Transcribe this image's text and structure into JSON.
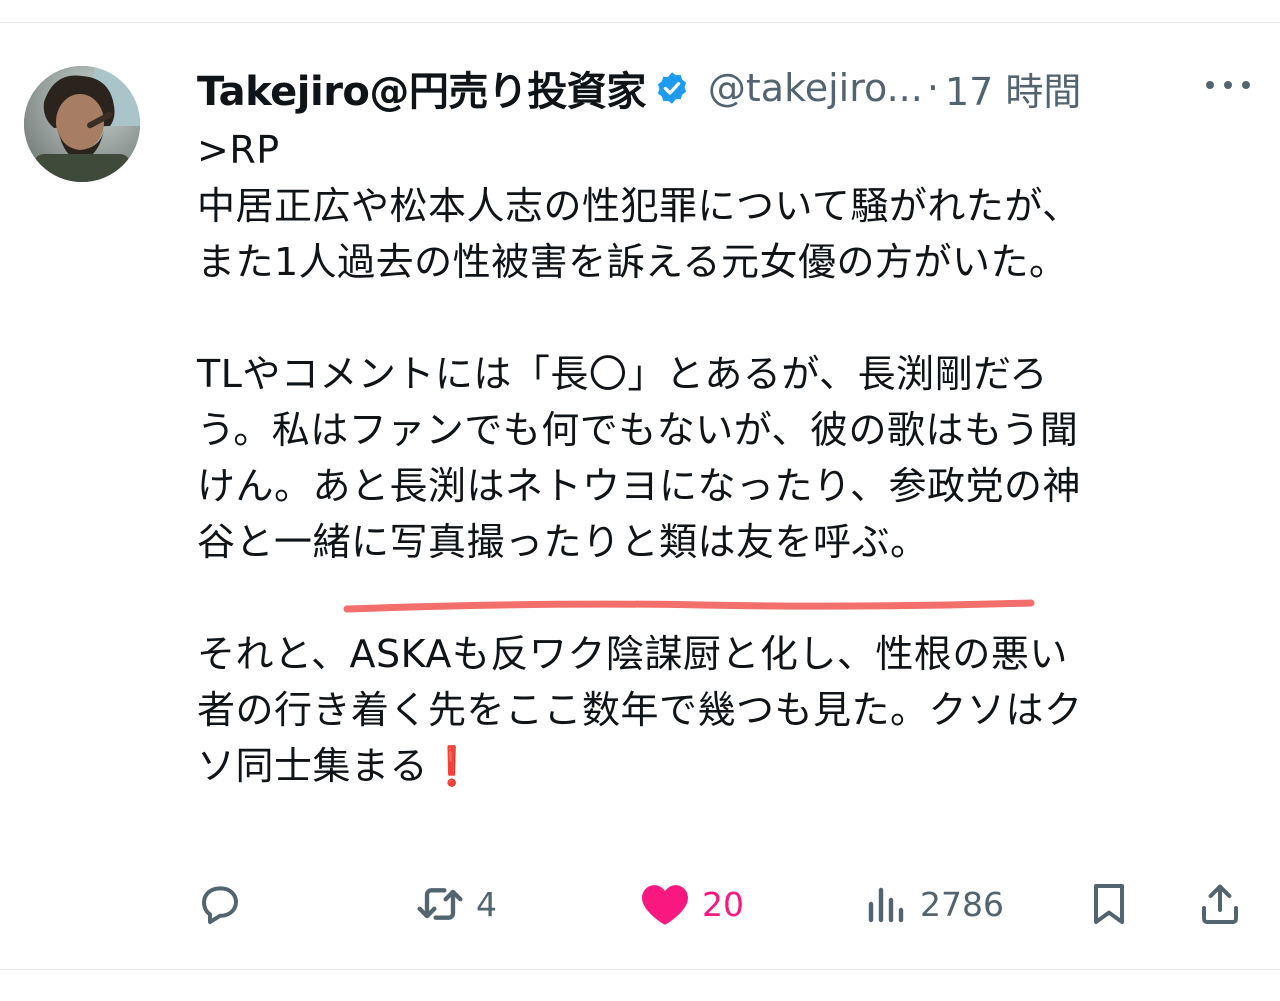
{
  "tweet": {
    "display_name": "Takejiro@円売り投資家",
    "handle": "@takejiro...",
    "separator": "·",
    "time": "17 時間",
    "body": ">RP\n中居正広や松本人志の性犯罪について騒がれたが、\nまた1人過去の性被害を訴える元女優の方がいた。\n\nTLやコメントには「長〇」とあるが、長渕剛だろ\nう。私はファンでも何でもないが、彼の歌はもう聞\nけん。あと長渕はネトウヨになったり、参政党の神\n谷と一緒に写真撮ったりと類は友を呼ぶ。\n\nそれと、ASKAも反ワク陰謀厨と化し、性根の悪い\n者の行き着く先をここ数年で幾つも見た。クソはク\nソ同士集まる❗",
    "verified": true
  },
  "actions": {
    "reply_count": "",
    "retweet_count": "4",
    "like_count": "20",
    "views_count": "2786"
  },
  "icons": {
    "verified": "verified-badge-icon",
    "more": "more-icon",
    "reply": "reply-icon",
    "retweet": "retweet-icon",
    "like": "heart-icon",
    "views": "views-icon",
    "bookmark": "bookmark-icon",
    "share": "share-icon"
  },
  "colors": {
    "verified": "#1d9bf0",
    "like": "#f91880",
    "secondary_text": "#536471",
    "highlight_underline": "#f25f5c"
  }
}
